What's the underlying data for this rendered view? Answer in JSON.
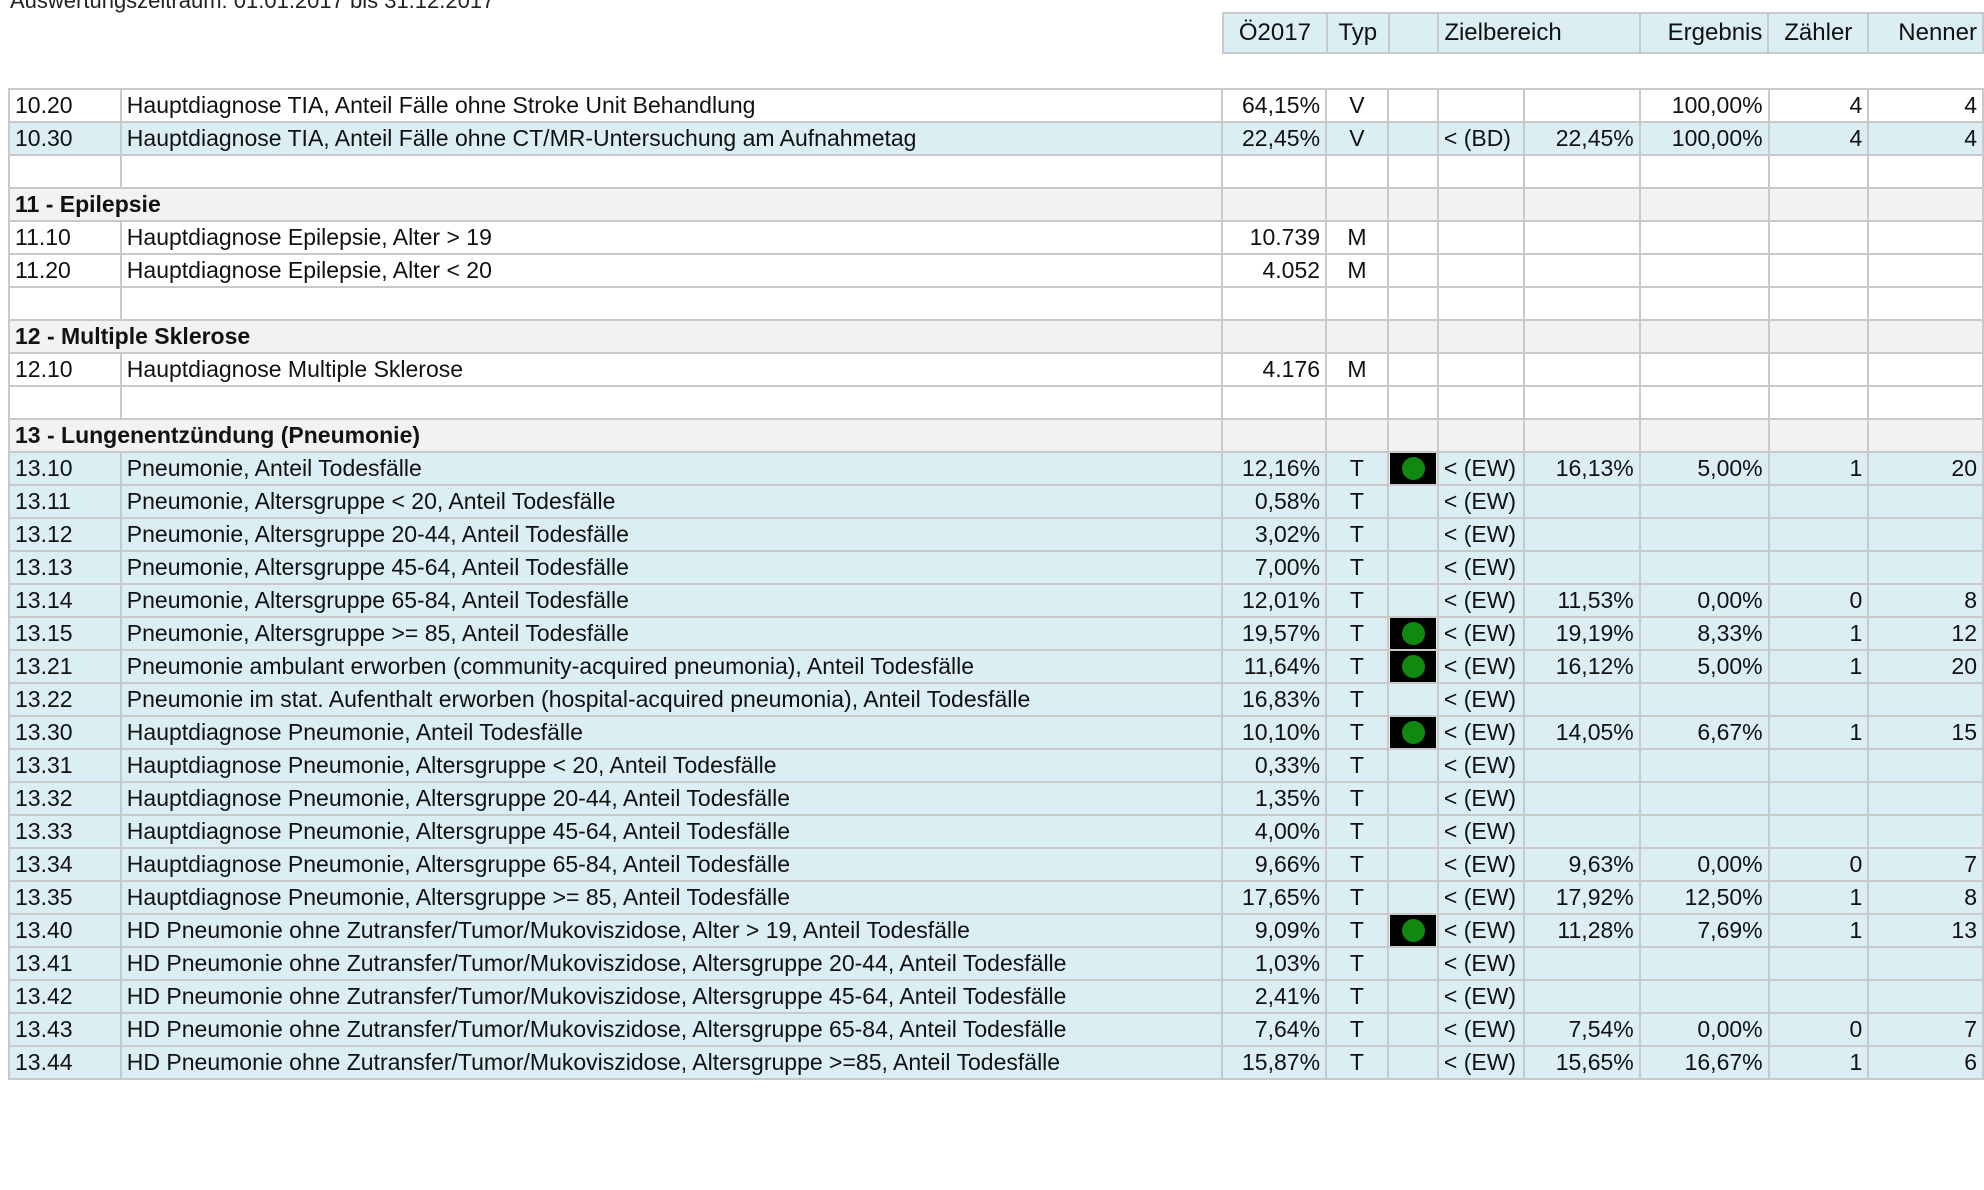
{
  "top_text": "Auswertungszeitraum: 01.01.2017 bis 31.12.2017",
  "header": {
    "oe2017": "Ö2017",
    "typ": "Typ",
    "zielbereich": "Zielbereich",
    "ergebnis": "Ergebnis",
    "zaehler": "Zähler",
    "nenner": "Nenner"
  },
  "rows": [
    {
      "kind": "data",
      "hl": false,
      "id": "10.20",
      "desc": "Hauptdiagnose TIA, Anteil Fälle ohne Stroke Unit Behandlung",
      "oe": "64,15%",
      "typ": "V",
      "light": "",
      "ziel": "",
      "zielwert": "",
      "ergebnis": "100,00%",
      "zaehler": "4",
      "nenner": "4"
    },
    {
      "kind": "data",
      "hl": true,
      "id": "10.30",
      "desc": "Hauptdiagnose TIA, Anteil Fälle ohne CT/MR-Untersuchung am Aufnahmetag",
      "oe": "22,45%",
      "typ": "V",
      "light": "",
      "ziel": "< (BD)",
      "zielwert": "22,45%",
      "ergebnis": "100,00%",
      "zaehler": "4",
      "nenner": "4"
    },
    {
      "kind": "empty"
    },
    {
      "kind": "section",
      "label": "11 - Epilepsie"
    },
    {
      "kind": "data",
      "hl": false,
      "id": "11.10",
      "desc": "Hauptdiagnose Epilepsie, Alter > 19",
      "oe": "10.739",
      "typ": "M",
      "light": "",
      "ziel": "",
      "zielwert": "",
      "ergebnis": "",
      "zaehler": "",
      "nenner": ""
    },
    {
      "kind": "data",
      "hl": false,
      "id": "11.20",
      "desc": "Hauptdiagnose Epilepsie, Alter < 20",
      "oe": "4.052",
      "typ": "M",
      "light": "",
      "ziel": "",
      "zielwert": "",
      "ergebnis": "",
      "zaehler": "",
      "nenner": ""
    },
    {
      "kind": "empty"
    },
    {
      "kind": "section",
      "label": "12 - Multiple Sklerose"
    },
    {
      "kind": "data",
      "hl": false,
      "id": "12.10",
      "desc": "Hauptdiagnose Multiple Sklerose",
      "oe": "4.176",
      "typ": "M",
      "light": "",
      "ziel": "",
      "zielwert": "",
      "ergebnis": "",
      "zaehler": "",
      "nenner": ""
    },
    {
      "kind": "empty"
    },
    {
      "kind": "section",
      "label": "13 - Lungenentzündung (Pneumonie)"
    },
    {
      "kind": "data",
      "hl": true,
      "id": "13.10",
      "desc": "Pneumonie, Anteil Todesfälle",
      "oe": "12,16%",
      "typ": "T",
      "light": "green",
      "ziel": "< (EW)",
      "zielwert": "16,13%",
      "ergebnis": "5,00%",
      "zaehler": "1",
      "nenner": "20"
    },
    {
      "kind": "data",
      "hl": true,
      "id": "13.11",
      "desc": "Pneumonie, Altersgruppe < 20, Anteil Todesfälle",
      "oe": "0,58%",
      "typ": "T",
      "light": "",
      "ziel": "< (EW)",
      "zielwert": "",
      "ergebnis": "",
      "zaehler": "",
      "nenner": ""
    },
    {
      "kind": "data",
      "hl": true,
      "id": "13.12",
      "desc": "Pneumonie, Altersgruppe 20-44, Anteil Todesfälle",
      "oe": "3,02%",
      "typ": "T",
      "light": "",
      "ziel": "< (EW)",
      "zielwert": "",
      "ergebnis": "",
      "zaehler": "",
      "nenner": ""
    },
    {
      "kind": "data",
      "hl": true,
      "id": "13.13",
      "desc": "Pneumonie, Altersgruppe 45-64, Anteil Todesfälle",
      "oe": "7,00%",
      "typ": "T",
      "light": "",
      "ziel": "< (EW)",
      "zielwert": "",
      "ergebnis": "",
      "zaehler": "",
      "nenner": ""
    },
    {
      "kind": "data",
      "hl": true,
      "id": "13.14",
      "desc": "Pneumonie, Altersgruppe 65-84, Anteil Todesfälle",
      "oe": "12,01%",
      "typ": "T",
      "light": "",
      "ziel": "< (EW)",
      "zielwert": "11,53%",
      "ergebnis": "0,00%",
      "zaehler": "0",
      "nenner": "8"
    },
    {
      "kind": "data",
      "hl": true,
      "id": "13.15",
      "desc": "Pneumonie, Altersgruppe >= 85, Anteil Todesfälle",
      "oe": "19,57%",
      "typ": "T",
      "light": "green",
      "ziel": "< (EW)",
      "zielwert": "19,19%",
      "ergebnis": "8,33%",
      "zaehler": "1",
      "nenner": "12"
    },
    {
      "kind": "data",
      "hl": true,
      "id": "13.21",
      "desc": "Pneumonie ambulant erworben (community-acquired pneumonia), Anteil Todesfälle",
      "oe": "11,64%",
      "typ": "T",
      "light": "green",
      "ziel": "< (EW)",
      "zielwert": "16,12%",
      "ergebnis": "5,00%",
      "zaehler": "1",
      "nenner": "20"
    },
    {
      "kind": "data",
      "hl": true,
      "id": "13.22",
      "desc": "Pneumonie im stat. Aufenthalt erworben (hospital-acquired pneumonia), Anteil Todesfälle",
      "oe": "16,83%",
      "typ": "T",
      "light": "",
      "ziel": "< (EW)",
      "zielwert": "",
      "ergebnis": "",
      "zaehler": "",
      "nenner": ""
    },
    {
      "kind": "data",
      "hl": true,
      "id": "13.30",
      "desc": "Hauptdiagnose Pneumonie, Anteil Todesfälle",
      "oe": "10,10%",
      "typ": "T",
      "light": "green",
      "ziel": "< (EW)",
      "zielwert": "14,05%",
      "ergebnis": "6,67%",
      "zaehler": "1",
      "nenner": "15"
    },
    {
      "kind": "data",
      "hl": true,
      "id": "13.31",
      "desc": "Hauptdiagnose Pneumonie, Altersgruppe < 20, Anteil Todesfälle",
      "oe": "0,33%",
      "typ": "T",
      "light": "",
      "ziel": "< (EW)",
      "zielwert": "",
      "ergebnis": "",
      "zaehler": "",
      "nenner": ""
    },
    {
      "kind": "data",
      "hl": true,
      "id": "13.32",
      "desc": "Hauptdiagnose Pneumonie, Altersgruppe 20-44, Anteil Todesfälle",
      "oe": "1,35%",
      "typ": "T",
      "light": "",
      "ziel": "< (EW)",
      "zielwert": "",
      "ergebnis": "",
      "zaehler": "",
      "nenner": ""
    },
    {
      "kind": "data",
      "hl": true,
      "id": "13.33",
      "desc": "Hauptdiagnose Pneumonie, Altersgruppe 45-64, Anteil Todesfälle",
      "oe": "4,00%",
      "typ": "T",
      "light": "",
      "ziel": "< (EW)",
      "zielwert": "",
      "ergebnis": "",
      "zaehler": "",
      "nenner": ""
    },
    {
      "kind": "data",
      "hl": true,
      "id": "13.34",
      "desc": "Hauptdiagnose Pneumonie, Altersgruppe 65-84, Anteil Todesfälle",
      "oe": "9,66%",
      "typ": "T",
      "light": "",
      "ziel": "< (EW)",
      "zielwert": "9,63%",
      "ergebnis": "0,00%",
      "zaehler": "0",
      "nenner": "7"
    },
    {
      "kind": "data",
      "hl": true,
      "id": "13.35",
      "desc": "Hauptdiagnose Pneumonie, Altersgruppe >= 85, Anteil Todesfälle",
      "oe": "17,65%",
      "typ": "T",
      "light": "",
      "ziel": "< (EW)",
      "zielwert": "17,92%",
      "ergebnis": "12,50%",
      "zaehler": "1",
      "nenner": "8"
    },
    {
      "kind": "data",
      "hl": true,
      "id": "13.40",
      "desc": "HD Pneumonie ohne Zutransfer/Tumor/Mukoviszidose, Alter > 19, Anteil Todesfälle",
      "oe": "9,09%",
      "typ": "T",
      "light": "green",
      "ziel": "< (EW)",
      "zielwert": "11,28%",
      "ergebnis": "7,69%",
      "zaehler": "1",
      "nenner": "13"
    },
    {
      "kind": "data",
      "hl": true,
      "id": "13.41",
      "desc": "HD Pneumonie ohne Zutransfer/Tumor/Mukoviszidose, Altersgruppe 20-44, Anteil Todesfälle",
      "oe": "1,03%",
      "typ": "T",
      "light": "",
      "ziel": "< (EW)",
      "zielwert": "",
      "ergebnis": "",
      "zaehler": "",
      "nenner": ""
    },
    {
      "kind": "data",
      "hl": true,
      "id": "13.42",
      "desc": "HD Pneumonie ohne Zutransfer/Tumor/Mukoviszidose, Altersgruppe 45-64, Anteil Todesfälle",
      "oe": "2,41%",
      "typ": "T",
      "light": "",
      "ziel": "< (EW)",
      "zielwert": "",
      "ergebnis": "",
      "zaehler": "",
      "nenner": ""
    },
    {
      "kind": "data",
      "hl": true,
      "id": "13.43",
      "desc": "HD Pneumonie ohne Zutransfer/Tumor/Mukoviszidose, Altersgruppe 65-84, Anteil Todesfälle",
      "oe": "7,64%",
      "typ": "T",
      "light": "",
      "ziel": "< (EW)",
      "zielwert": "7,54%",
      "ergebnis": "0,00%",
      "zaehler": "0",
      "nenner": "7"
    },
    {
      "kind": "data",
      "hl": true,
      "id": "13.44",
      "desc": "HD Pneumonie ohne Zutransfer/Tumor/Mukoviszidose, Altersgruppe >=85, Anteil Todesfälle",
      "oe": "15,87%",
      "typ": "T",
      "light": "",
      "ziel": "< (EW)",
      "zielwert": "15,65%",
      "ergebnis": "16,67%",
      "zaehler": "1",
      "nenner": "6"
    }
  ]
}
